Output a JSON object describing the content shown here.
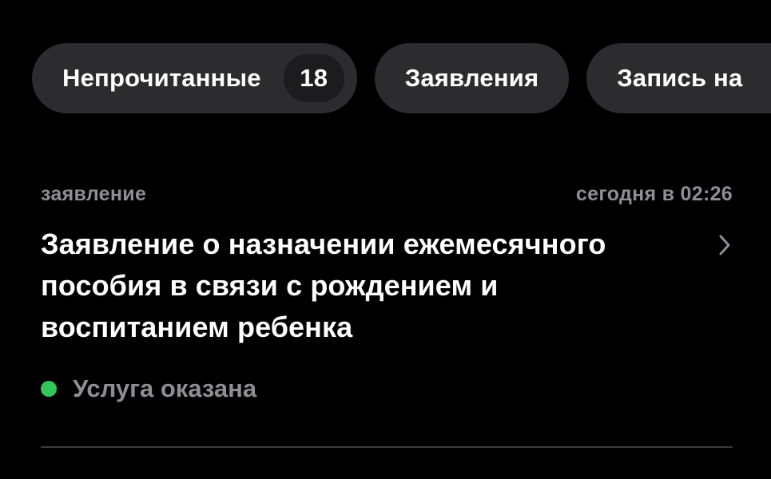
{
  "filters": {
    "unread": {
      "label": "Непрочитанные",
      "count": "18"
    },
    "applications": {
      "label": "Заявления"
    },
    "appointments": {
      "label": "Запись на"
    }
  },
  "item": {
    "category": "заявление",
    "timestamp": "сегодня в 02:26",
    "title": "Заявление о назначении ежемесячного пособия в связи с рождением и воспитанием ребенка",
    "status": "Услуга оказана",
    "status_color": "#33c759",
    "chevron_icon": "chevron-right-icon"
  },
  "colors": {
    "background": "#000000",
    "chip_bg": "#2c2c2e",
    "secondary_text": "#8e8e93",
    "success": "#33c759"
  }
}
